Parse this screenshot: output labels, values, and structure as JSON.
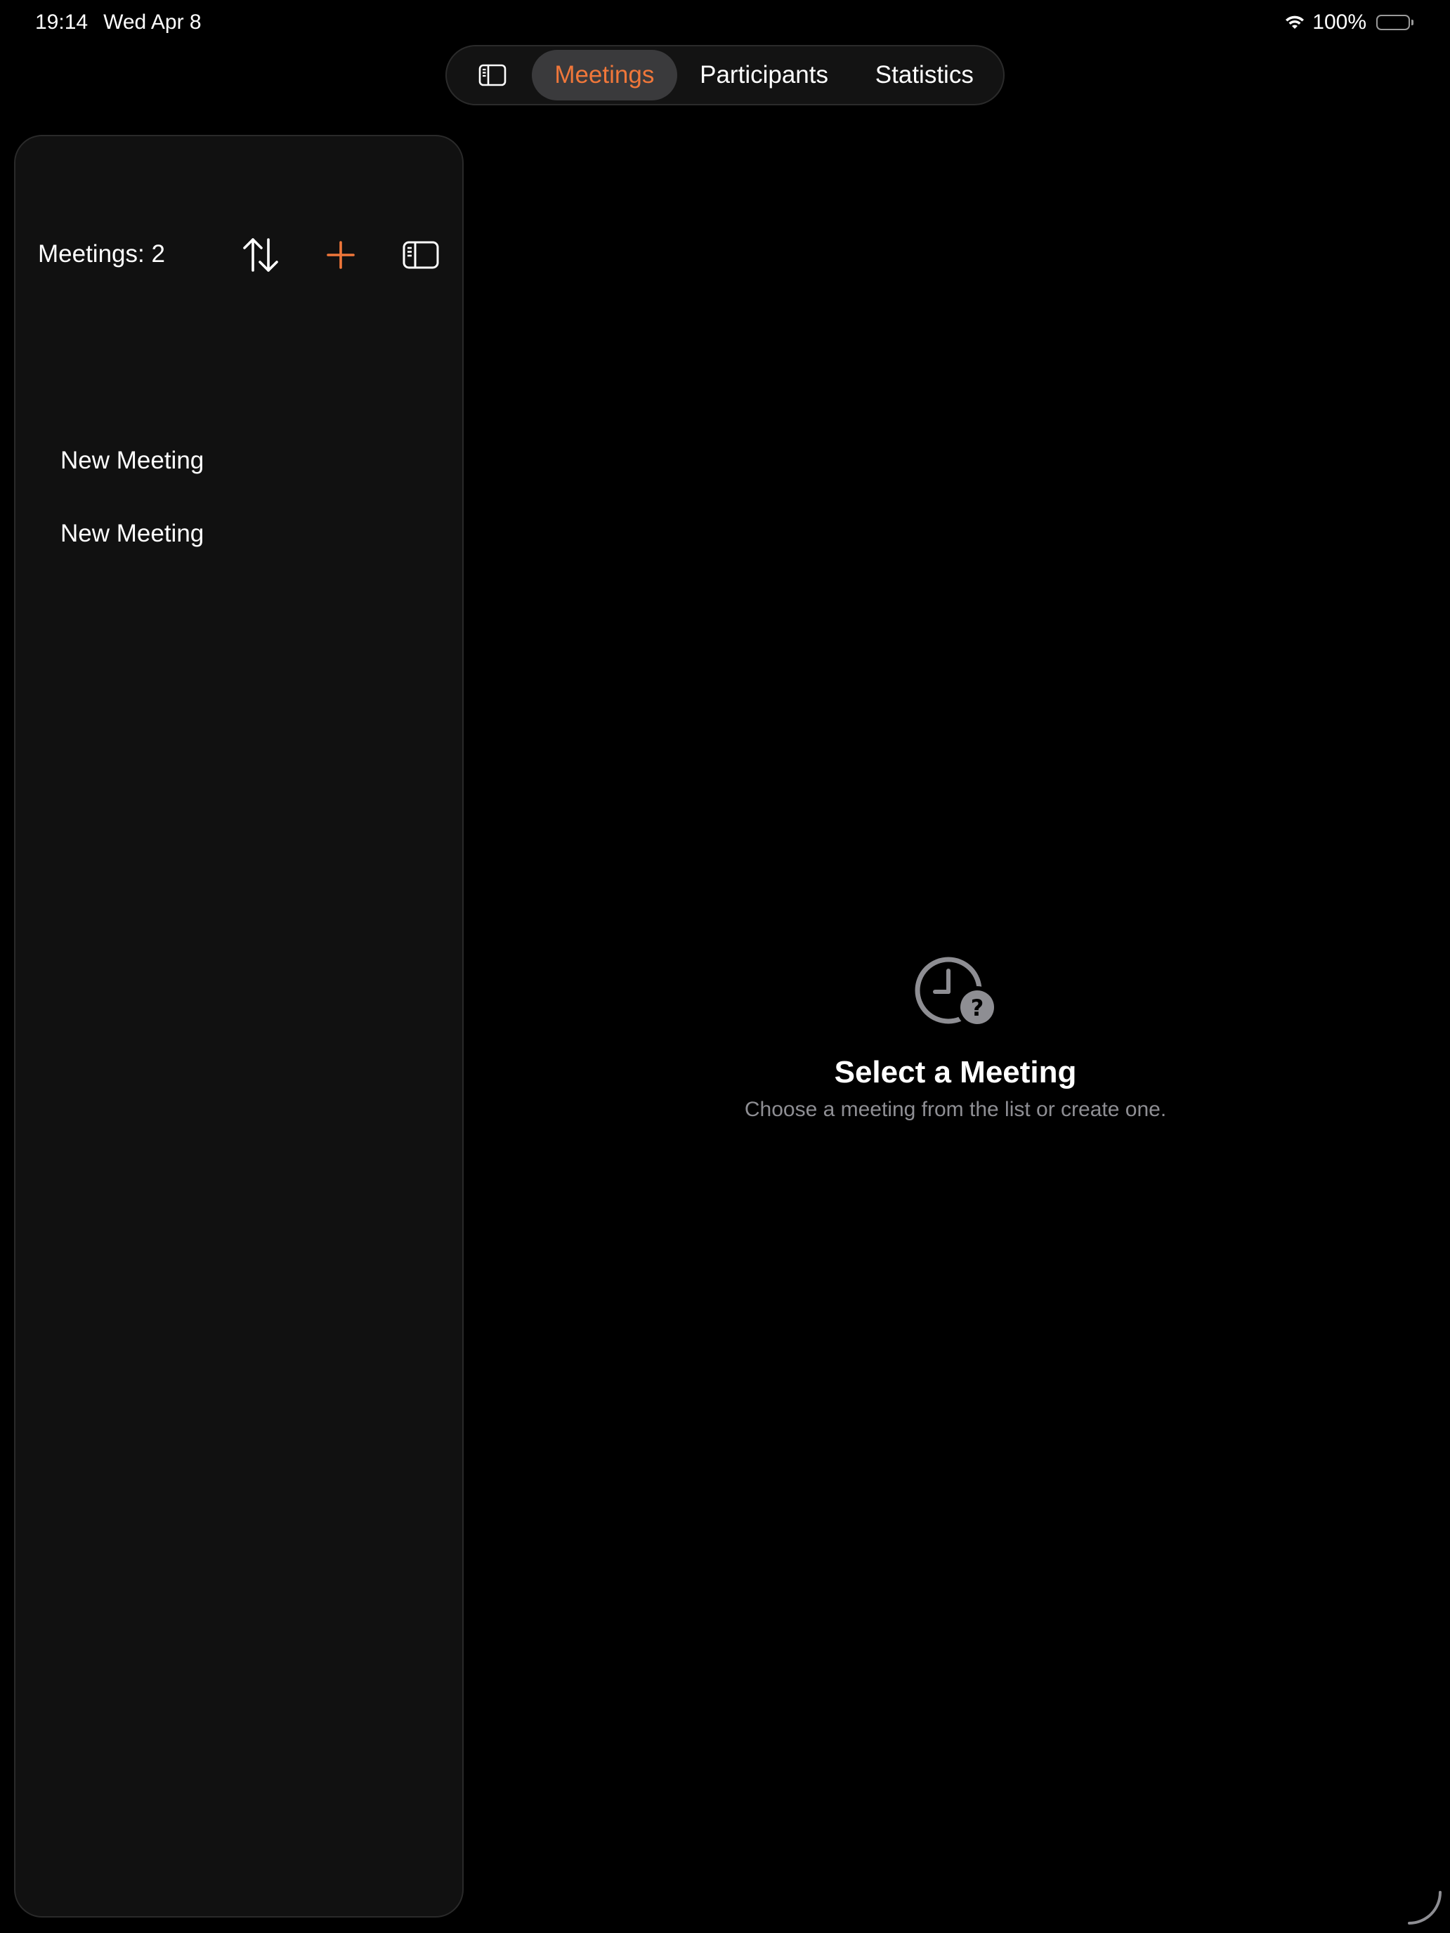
{
  "status_bar": {
    "time": "19:14",
    "date": "Wed Apr 8",
    "battery": "100%",
    "battery_level": 1.0
  },
  "tabbar": {
    "sidebar_toggle_icon": "sidebar-left-icon",
    "tabs": [
      {
        "label": "Meetings",
        "active": true
      },
      {
        "label": "Participants",
        "active": false
      },
      {
        "label": "Statistics",
        "active": false
      }
    ]
  },
  "sidebar": {
    "count_label": "Meetings: 2",
    "sort_icon": "sort-arrows-icon",
    "add_icon": "plus-icon",
    "toggle_icon": "sidebar-left-icon",
    "meetings": [
      {
        "title": "New Meeting"
      },
      {
        "title": "New Meeting"
      }
    ]
  },
  "empty_state": {
    "icon": "clock-question-icon",
    "title": "Select a Meeting",
    "subtitle": "Choose a meeting from the list or create one."
  },
  "colors": {
    "accent": "#f0773a",
    "background": "#000000",
    "sidebar_bg": "#111111",
    "secondary_text": "#8e8e93",
    "active_tab_bg": "#3a3a3c"
  }
}
